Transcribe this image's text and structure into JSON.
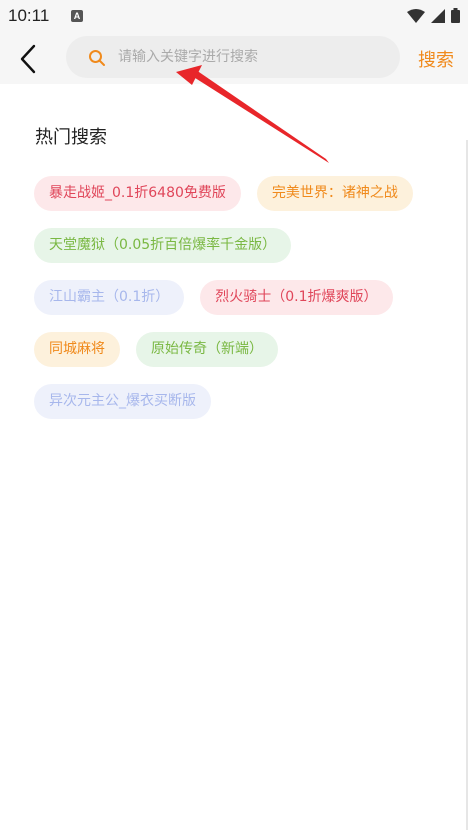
{
  "status_bar": {
    "time": "10:11",
    "notification_letter": "A"
  },
  "header": {
    "search_placeholder": "请输入关键字进行搜索",
    "search_value": "",
    "search_button_label": "搜索"
  },
  "hot_search": {
    "title": "热门搜索",
    "rows": [
      [
        {
          "label": "暴走战姬_0.1折6480免费版",
          "color": "#e0465a"
        },
        {
          "label": "完美世界：诸神之战",
          "color": "#f08a1c"
        }
      ],
      [
        {
          "label": "天堂魔狱（0.05折百倍爆率千金版）",
          "color": "#7ab843"
        }
      ],
      [
        {
          "label": "江山霸主（0.1折）",
          "color": "#a7b7ec"
        },
        {
          "label": "烈火骑士（0.1折爆爽版）",
          "color": "#e0465a"
        }
      ],
      [
        {
          "label": "同城麻将",
          "color": "#f08a1c"
        },
        {
          "label": "原始传奇（新端）",
          "color": "#7ab843"
        }
      ],
      [
        {
          "label": "异次元主公_爆衣买断版",
          "color": "#a7b7ec"
        }
      ]
    ]
  },
  "colors": {
    "accent": "#f08a1c",
    "annotation_arrow": "#e8262a"
  }
}
